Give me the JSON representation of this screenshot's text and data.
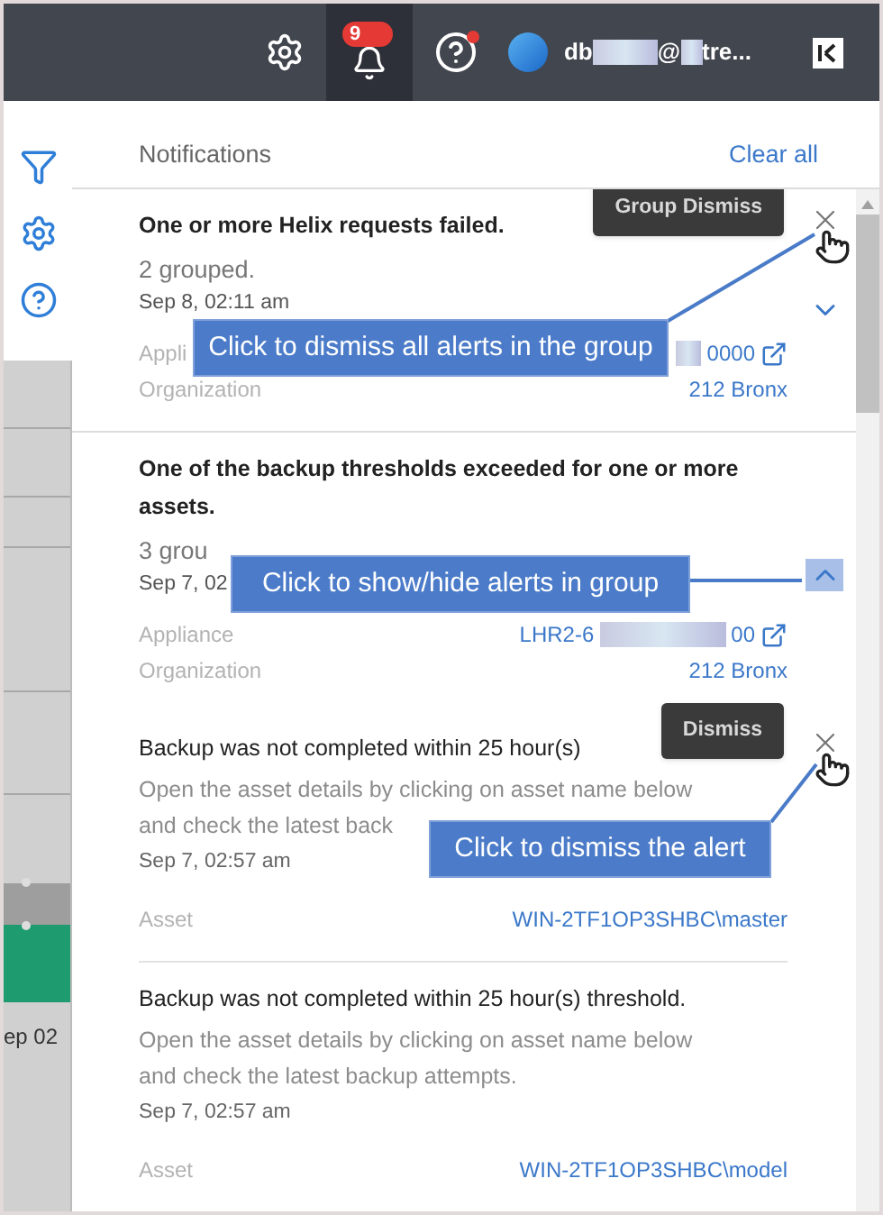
{
  "topbar": {
    "badge": "9",
    "help_dot": true,
    "user": {
      "name_start": "db",
      "name_mid": "@",
      "name_end": "tre..."
    }
  },
  "chart_label": "ep 02",
  "panel": {
    "title": "Notifications",
    "clear": "Clear all"
  },
  "notifications": [
    {
      "kind": "group",
      "title": "One or more Helix requests failed.",
      "grouped": "2 grouped.",
      "time": "Sep 8, 02:11 am",
      "expanded": false,
      "toggle_highlighted": false,
      "tooltip": "Group Dismiss",
      "fields": [
        {
          "label": "Appli",
          "value_end": "0000",
          "redacted": true,
          "link": true
        },
        {
          "label": "Organization",
          "value_end": "212 Bronx",
          "redacted": false,
          "link": false
        }
      ]
    },
    {
      "kind": "group",
      "title": "One of the backup thresholds exceeded for one or more assets.",
      "grouped": "3 grou",
      "time": "Sep 7, 02",
      "expanded": true,
      "toggle_highlighted": true,
      "fields": [
        {
          "label": "Appliance",
          "value_start": "LHR2-6",
          "value_end": "00",
          "redacted": true,
          "link": true
        },
        {
          "label": "Organization",
          "value_end": "212 Bronx",
          "redacted": false,
          "link": false
        }
      ],
      "children": [
        {
          "kind": "alert",
          "title": "Backup was not completed within 25 hour(s)",
          "desc": [
            "Open the asset details by clicking on asset name below",
            "and check the latest back"
          ],
          "time": "Sep 7, 02:57 am",
          "tooltip": "Dismiss",
          "fields": [
            {
              "label": "Asset",
              "value_end": "WIN-2TF1OP3SHBC\\master",
              "redacted": false,
              "link": false
            }
          ]
        },
        {
          "kind": "alert",
          "title": "Backup was not completed within 25 hour(s) threshold.",
          "desc": [
            "Open the asset details by clicking on asset name below",
            "and check the latest backup attempts."
          ],
          "time": "Sep 7, 02:57 am",
          "fields": [
            {
              "label": "Asset",
              "value_end": "WIN-2TF1OP3SHBC\\model",
              "redacted": false,
              "link": false
            }
          ]
        }
      ]
    }
  ],
  "callouts": [
    {
      "text": "Click to dismiss all alerts in the group"
    },
    {
      "text": "Click to show/hide alerts in group"
    },
    {
      "text": "Click to dismiss the alert"
    }
  ]
}
